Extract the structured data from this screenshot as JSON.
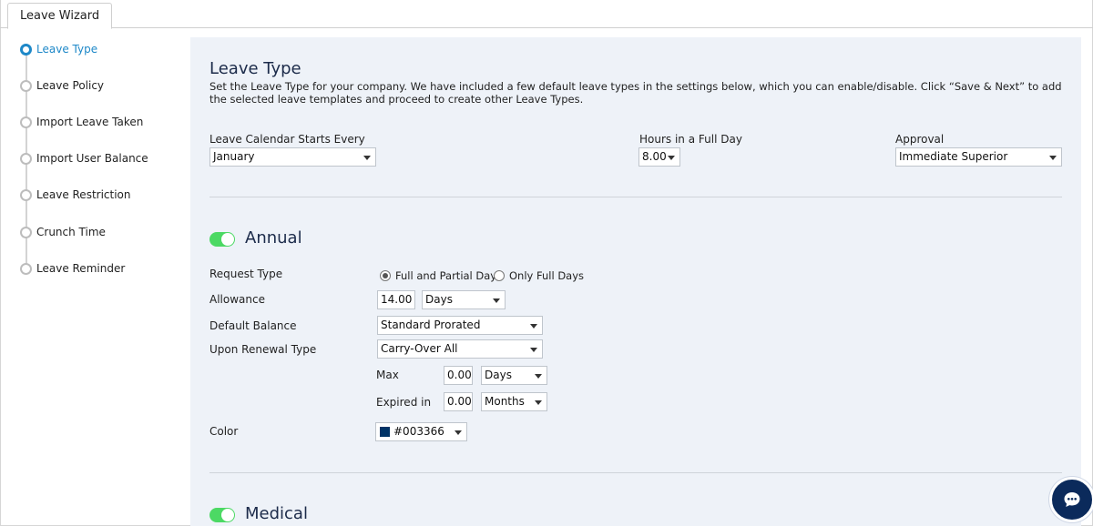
{
  "tab": {
    "label": "Leave Wizard"
  },
  "steps": [
    {
      "label": "Leave Type",
      "active": true
    },
    {
      "label": "Leave Policy"
    },
    {
      "label": "Import Leave Taken"
    },
    {
      "label": "Import User Balance"
    },
    {
      "label": "Leave Restriction"
    },
    {
      "label": "Crunch Time"
    },
    {
      "label": "Leave Reminder"
    }
  ],
  "page": {
    "title": "Leave Type",
    "description": "Set the Leave Type for your company. We have included a few default leave types in the settings below, which you can enable/disable. Click “Save & Next” to add the selected leave templates and proceed to create other Leave Types."
  },
  "settings": {
    "calendar_label": "Leave Calendar Starts Every",
    "calendar_value": "January",
    "hours_label": "Hours in a Full Day",
    "hours_value": "8.00",
    "approval_label": "Approval",
    "approval_value": "Immediate Superior"
  },
  "annual": {
    "title": "Annual",
    "enabled": true,
    "request_type_label": "Request Type",
    "request_option_1": "Full and Partial Days",
    "request_option_2": "Only Full Days",
    "allowance_label": "Allowance",
    "allowance_value": "14.00",
    "allowance_unit": "Days",
    "default_balance_label": "Default Balance",
    "default_balance_value": "Standard Prorated",
    "renewal_label": "Upon Renewal Type",
    "renewal_value": "Carry-Over All",
    "max_label": "Max",
    "max_value": "0.00",
    "max_unit": "Days",
    "expired_label": "Expired in",
    "expired_value": "0.00",
    "expired_unit": "Months",
    "color_label": "Color",
    "color_value": "#003366"
  },
  "medical": {
    "title": "Medical",
    "enabled": true
  },
  "colors": {
    "accent": "#1e88c8",
    "toggle_on": "#4cd964",
    "panel_bg": "#eef2f8",
    "chat_bg": "#0b2a5b"
  },
  "icons": {
    "chat": "chat-bubble-icon"
  }
}
